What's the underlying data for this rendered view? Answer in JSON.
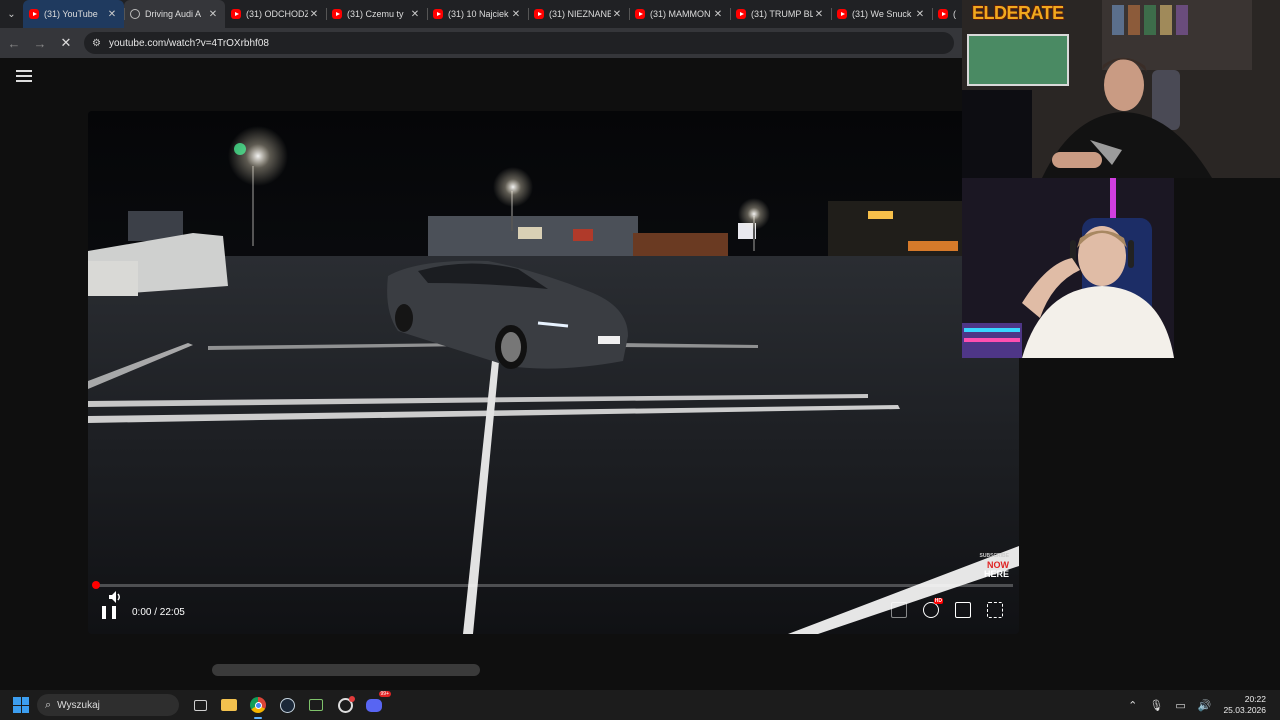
{
  "browser": {
    "tabs": [
      {
        "title": "(31) YouTube",
        "favicon": "youtube-icon",
        "state": "hover"
      },
      {
        "title": "Driving Audi A",
        "favicon": "loading-icon",
        "state": "active"
      },
      {
        "title": "(31) ODCHODZ",
        "favicon": "youtube-icon"
      },
      {
        "title": "(31) Czemu ty",
        "favicon": "youtube-icon"
      },
      {
        "title": "(31) 10 Najciek",
        "favicon": "youtube-icon"
      },
      {
        "title": "(31) NIEZNANE",
        "favicon": "youtube-icon"
      },
      {
        "title": "(31) MAMMON",
        "favicon": "youtube-icon"
      },
      {
        "title": "(31) TRUMP BL",
        "favicon": "youtube-icon"
      },
      {
        "title": "(31) We Snuck",
        "favicon": "youtube-icon"
      },
      {
        "title": "(3",
        "favicon": "youtube-icon"
      }
    ],
    "url": "youtube.com/watch?v=4TrOXrbhf08"
  },
  "player": {
    "time": "0:00 / 22:05",
    "progress": 0,
    "hd_badge": "HD",
    "subscribe_small": "SUBSCRIBE",
    "subscribe_now": "NOW",
    "subscribe_here": "HERE"
  },
  "stream": {
    "logo_text": "ELDERATE"
  },
  "taskbar": {
    "search_placeholder": "Wyszukaj",
    "notification_badge": "99+",
    "time": "20:22",
    "date": "25.03.2026"
  },
  "colors": {
    "accent_red": "#ff0000",
    "chrome_tab": "#35363a",
    "windows_blue": "#3c9ef0"
  }
}
